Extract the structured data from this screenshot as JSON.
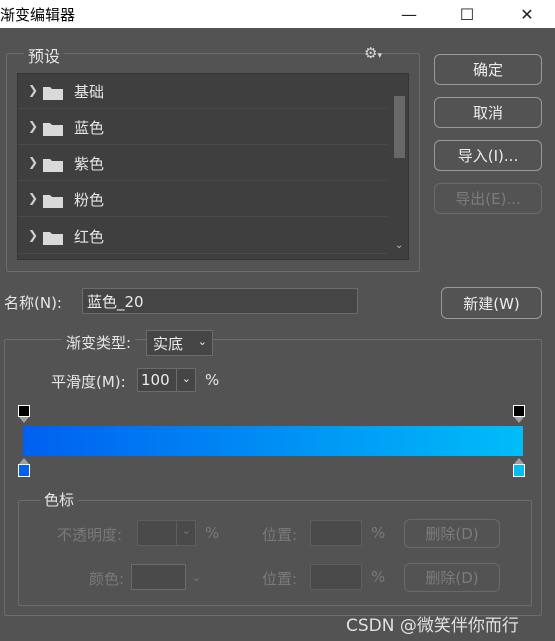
{
  "window": {
    "title": "渐变编辑器",
    "minimize": "—",
    "maximize": "☐",
    "close": "✕"
  },
  "presets": {
    "legend": "预设",
    "gear": "⚙",
    "items": [
      {
        "label": "基础"
      },
      {
        "label": "蓝色"
      },
      {
        "label": "紫色"
      },
      {
        "label": "粉色"
      },
      {
        "label": "红色"
      }
    ]
  },
  "buttons": {
    "ok": "确定",
    "cancel": "取消",
    "import": "导入(I)...",
    "export": "导出(E)...",
    "new": "新建(W)"
  },
  "name": {
    "label": "名称(N):",
    "value": "蓝色_20"
  },
  "gradient": {
    "type_label": "渐变类型:",
    "type_value": "实底",
    "smooth_label": "平滑度(M):",
    "smooth_value": "100",
    "smooth_unit": "%",
    "start_color": "#0060f0",
    "end_color": "#00bdf8"
  },
  "stops": {
    "legend": "色标",
    "opacity_label": "不透明度:",
    "opacity_unit": "%",
    "position_label": "位置:",
    "position_unit": "%",
    "delete_label": "删除(D)",
    "color_label": "颜色:",
    "position2_label": "位置:",
    "position2_unit": "%",
    "delete2_label": "删除(D)"
  },
  "watermark": "CSDN @微笑伴你而行"
}
